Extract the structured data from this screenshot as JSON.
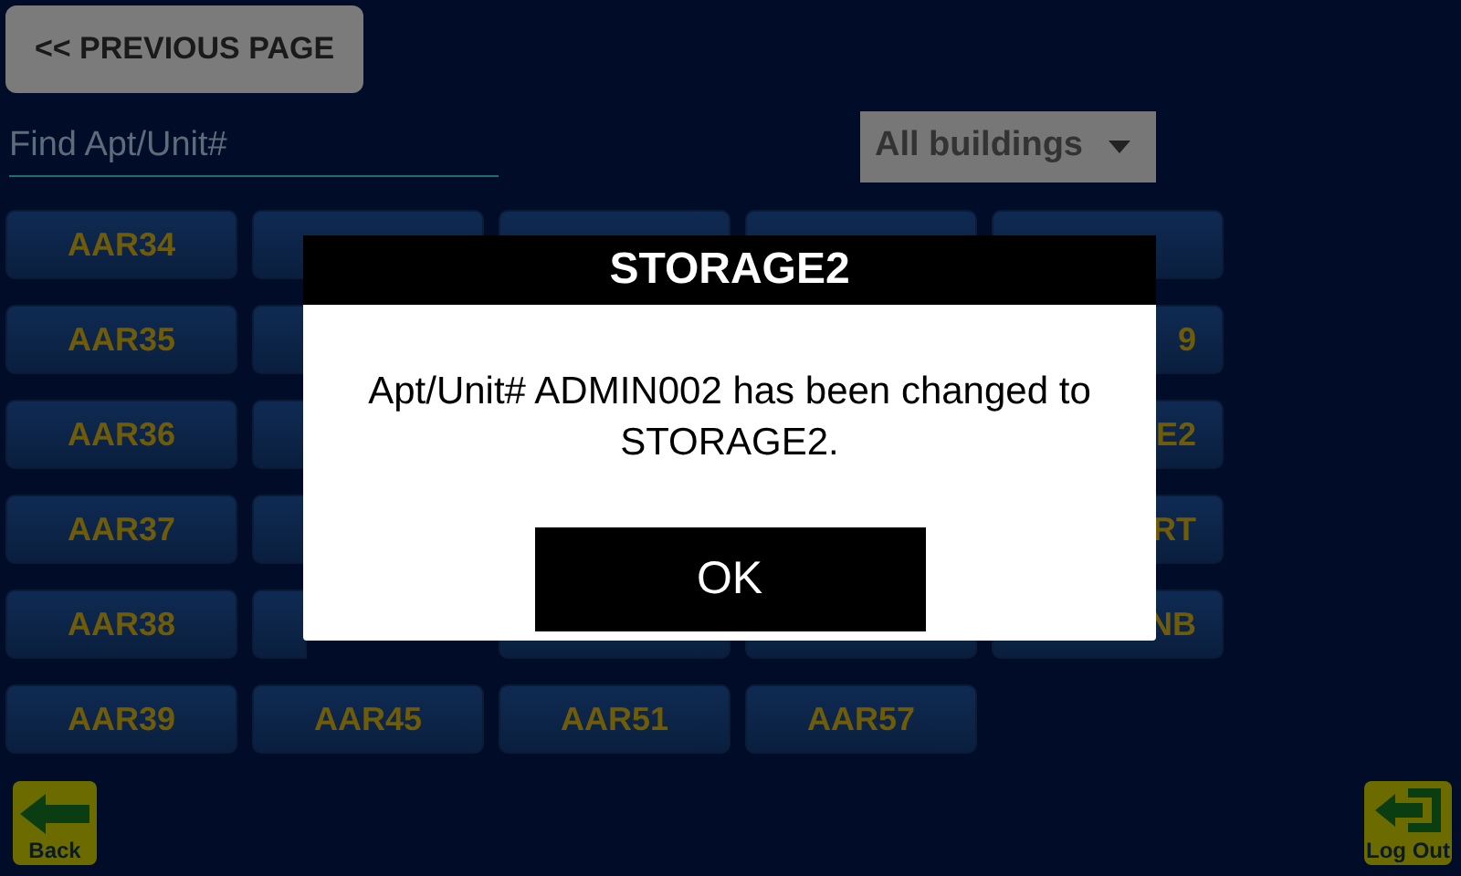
{
  "previous_button": "<< PREVIOUS PAGE",
  "search": {
    "placeholder": "Find Apt/Unit#"
  },
  "building_filter": {
    "value": "All buildings"
  },
  "unit_rows": [
    [
      {
        "kind": "full",
        "label": "AAR34"
      },
      {
        "kind": "covered"
      },
      {
        "kind": "covered"
      },
      {
        "kind": "covered"
      },
      {
        "kind": "covered"
      }
    ],
    [
      {
        "kind": "full",
        "label": "AAR35"
      },
      {
        "kind": "edge"
      },
      null,
      null,
      {
        "kind": "fragment",
        "label": "9"
      }
    ],
    [
      {
        "kind": "full",
        "label": "AAR36"
      },
      {
        "kind": "edge"
      },
      null,
      null,
      {
        "kind": "fragment",
        "label": "E2"
      }
    ],
    [
      {
        "kind": "full",
        "label": "AAR37"
      },
      {
        "kind": "edge"
      },
      null,
      null,
      {
        "kind": "fragment",
        "label": "RT"
      }
    ],
    [
      {
        "kind": "full",
        "label": "AAR38"
      },
      {
        "kind": "edge"
      },
      {
        "kind": "covered"
      },
      {
        "kind": "covered"
      },
      {
        "kind": "fragment",
        "label": "NB"
      }
    ],
    [
      {
        "kind": "full",
        "label": "AAR39"
      },
      {
        "kind": "full",
        "label": "AAR45"
      },
      {
        "kind": "full",
        "label": "AAR51"
      },
      {
        "kind": "full",
        "label": "AAR57"
      }
    ]
  ],
  "dialog": {
    "title": "STORAGE2",
    "message": "Apt/Unit# ADMIN002 has been changed to STORAGE2.",
    "button": "OK"
  },
  "footer": {
    "back": "Back",
    "logout": "Log Out"
  }
}
